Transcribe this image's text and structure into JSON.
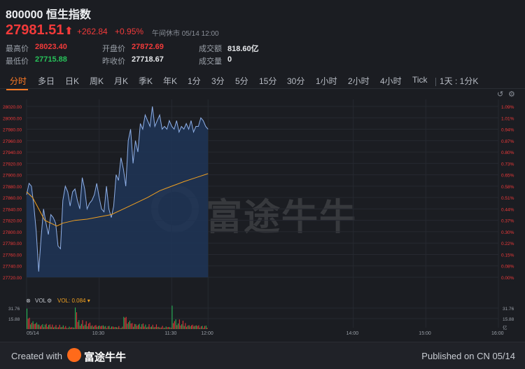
{
  "header": {
    "title": "800000 恒生指数",
    "price": "27981.51",
    "arrow": "⬆",
    "change": "+262.84",
    "change_pct": "+0.95%",
    "status": "午间休市 05/14 12:00"
  },
  "stats": {
    "high_label": "最高价",
    "high_value": "28023.40",
    "low_label": "最低价",
    "low_value": "27715.88",
    "open_label": "开盘价",
    "open_value": "27872.69",
    "prev_close_label": "昨收价",
    "prev_close_value": "27718.67",
    "turnover_label": "成交额",
    "turnover_value": "818.60亿",
    "volume_label": "成交量",
    "volume_value": "0"
  },
  "tabs": [
    "分时",
    "多日",
    "日K",
    "周K",
    "月K",
    "季K",
    "年K",
    "1分",
    "3分",
    "5分",
    "15分",
    "30分",
    "1小时",
    "2小时",
    "4小时",
    "Tick",
    "1天 : 1分K"
  ],
  "active_tab": "分时",
  "volume": {
    "label": "VOL",
    "value_label": "VOL: 0.084 ▾",
    "ticks_left": [
      "31.76",
      "15.88"
    ],
    "ticks_right": [
      "31.76",
      "15.88",
      "亿"
    ]
  },
  "footer": {
    "created_with": "Created with",
    "brand": "富途牛牛",
    "published": "Published on CN 05/14"
  },
  "watermark": "富途牛牛",
  "colors": {
    "up": "#f23a3a",
    "down": "#27c25a",
    "accent": "#ff7a24",
    "price_line": "#8fb0e8",
    "avg_line": "#f0a020"
  },
  "icons": [
    "arrow-up-icon",
    "undo-icon",
    "settings-icon",
    "close-icon",
    "dropdown-icon",
    "futu-logo-icon"
  ],
  "chart_data": {
    "type": "line",
    "title": "",
    "y_ticks": [
      "28020.00",
      "28000.00",
      "27980.00",
      "27960.00",
      "27940.00",
      "27920.00",
      "27900.00",
      "27880.00",
      "27860.00",
      "27840.00",
      "27820.00",
      "27800.00",
      "27780.00",
      "27760.00",
      "27740.00",
      "27720.00"
    ],
    "y_pct_ticks": [
      "1.09%",
      "1.01%",
      "0.94%",
      "0.87%",
      "0.80%",
      "0.73%",
      "0.65%",
      "0.58%",
      "0.51%",
      "0.44%",
      "0.37%",
      "0.30%",
      "0.22%",
      "0.15%",
      "0.08%",
      "0.00%"
    ],
    "ylim": [
      27720,
      28020
    ],
    "x_ticks": [
      "05/14",
      "10:30",
      "11:30",
      "12:00",
      "14:00",
      "15:00",
      "16:00"
    ],
    "x_tick_minutes": [
      0,
      60,
      120,
      150,
      270,
      330,
      390
    ],
    "x_range_minutes": [
      0,
      390
    ],
    "series": [
      {
        "t": [
          0,
          2,
          4,
          6,
          8,
          10,
          12,
          14,
          16,
          18,
          20,
          22,
          24,
          26,
          28,
          30,
          32,
          34,
          36,
          38,
          40,
          42,
          44,
          46,
          48,
          50,
          52,
          54,
          56,
          58,
          60,
          62,
          64,
          66,
          68,
          70,
          72,
          74,
          76,
          78,
          80,
          82,
          84,
          86,
          88,
          90,
          92,
          94,
          96,
          98,
          100,
          102,
          104,
          106,
          108,
          110,
          112,
          114,
          116,
          118,
          120,
          122,
          124,
          126,
          128,
          130,
          132,
          134,
          136,
          138,
          140,
          142,
          144,
          146,
          148,
          150
        ],
        "values": [
          27865,
          27885,
          27880,
          27845,
          27800,
          27730,
          27790,
          27840,
          27815,
          27795,
          27830,
          27825,
          27815,
          27775,
          27770,
          27855,
          27880,
          27870,
          27845,
          27870,
          27875,
          27855,
          27840,
          27895,
          27875,
          27840,
          27850,
          27855,
          27865,
          27885,
          27860,
          27840,
          27835,
          27880,
          27840,
          27825,
          27845,
          27900,
          27890,
          27930,
          27910,
          27880,
          27960,
          27980,
          27920,
          27960,
          27940,
          27990,
          27980,
          28005,
          27995,
          27985,
          28020,
          27985,
          27995,
          28005,
          27980,
          27985,
          27980,
          27995,
          27985,
          27980,
          27995,
          27975,
          27985,
          27980,
          27990,
          27980,
          27995,
          27975,
          27985,
          27985,
          28000,
          27995,
          27985,
          27980
        ]
      },
      {
        "t": [
          0,
          5,
          10,
          15,
          20,
          25,
          30,
          40,
          50,
          60,
          70,
          80,
          90,
          100,
          110,
          120,
          130,
          140,
          150
        ],
        "values": [
          27870,
          27860,
          27840,
          27820,
          27815,
          27810,
          27815,
          27820,
          27822,
          27826,
          27830,
          27840,
          27850,
          27860,
          27872,
          27880,
          27888,
          27895,
          27902
        ]
      }
    ],
    "volume_values_sample": [
      31.2,
      18,
      14,
      12,
      10,
      9,
      11,
      8,
      7,
      9,
      6,
      8,
      7,
      6,
      5,
      7,
      6,
      5,
      6,
      5,
      4,
      6,
      5,
      4,
      5,
      4,
      3,
      5,
      4,
      3,
      4,
      3,
      4,
      3,
      2,
      3,
      4,
      3,
      2,
      3
    ]
  }
}
